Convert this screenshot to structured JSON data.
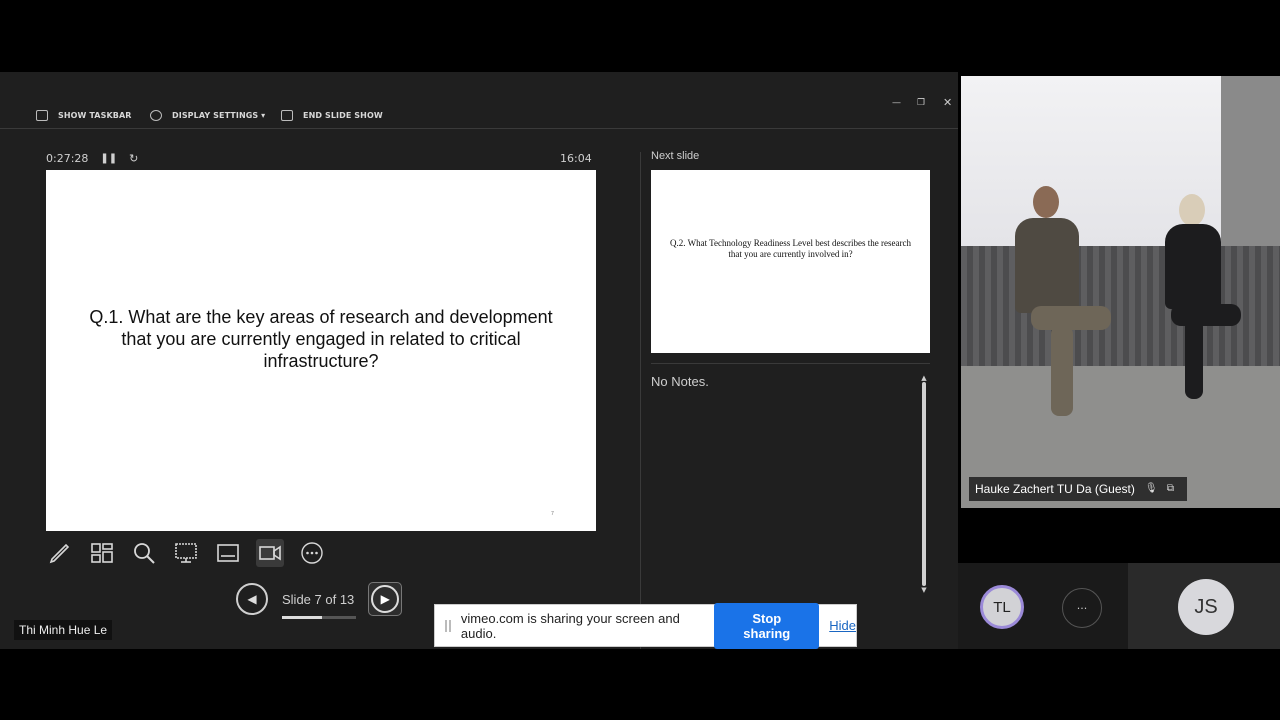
{
  "toolbar": {
    "show_taskbar": "SHOW TASKBAR",
    "display_settings": "DISPLAY SETTINGS ▾",
    "end_slide_show": "END SLIDE SHOW"
  },
  "presenter": {
    "elapsed": "0:27:28",
    "clock": "16:04",
    "current_slide_text": "Q.1. What are the key areas of research and development that you are currently engaged in related to critical infrastructure?",
    "current_slide_number": "7",
    "slide_counter": "Slide 7 of 13",
    "slide_progress": 0.54,
    "next_slide_label": "Next slide",
    "next_slide_text": "Q.2. What Technology Readiness Level best describes the research that you are currently involved in?",
    "notes": "No Notes.",
    "presenter_name": "Thi Minh Hue Le"
  },
  "share_banner": {
    "message": "vimeo.com is sharing your screen and audio.",
    "stop_label": "Stop sharing",
    "hide_label": "Hide"
  },
  "video": {
    "participant_label": "Hauke Zachert TU Da (Guest)"
  },
  "participants": {
    "tl_initials": "TL",
    "more_label": "···",
    "js_initials": "JS"
  },
  "colors": {
    "accent": "#1a73e8",
    "panel": "#1f1f1f",
    "tl_ring": "#9b8ad8"
  }
}
